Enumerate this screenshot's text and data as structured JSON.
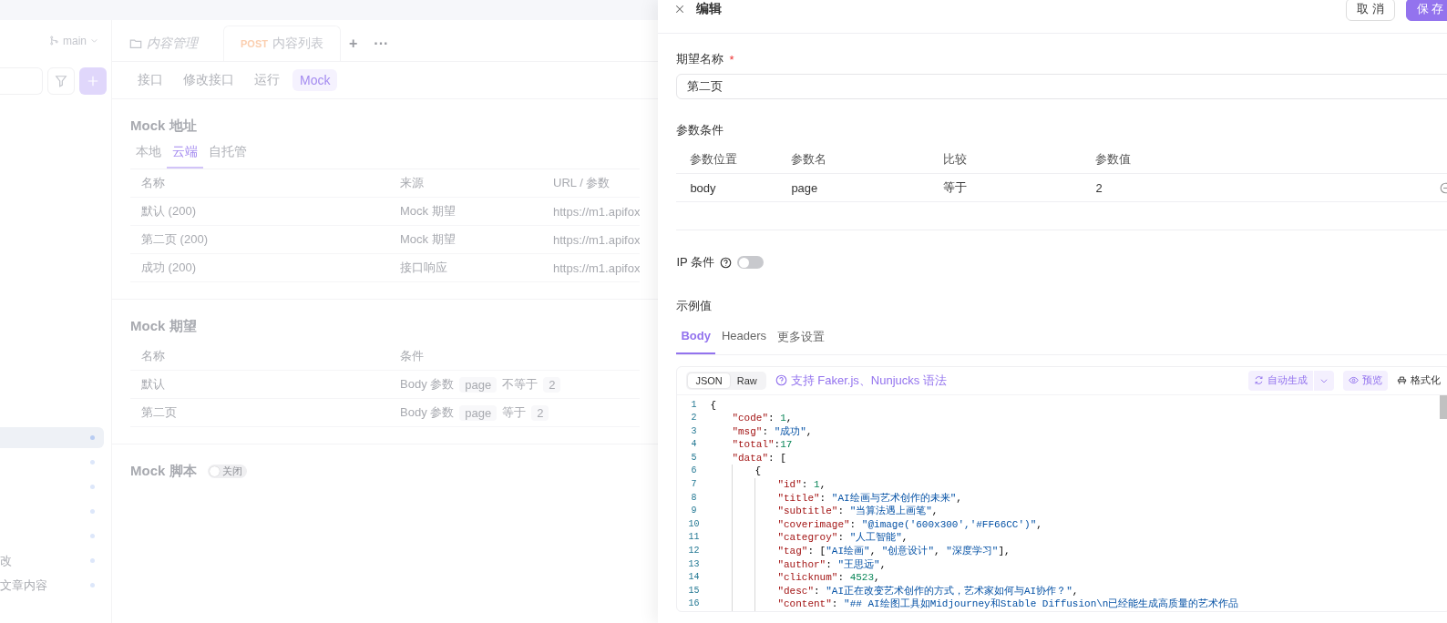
{
  "sidebar": {
    "branch": "main",
    "items": [
      {
        "selected": true
      },
      {
        "selected": false
      },
      {
        "selected": false
      },
      {
        "selected": false
      },
      {
        "selected": false
      },
      {
        "label": "改",
        "selected": false
      },
      {
        "label": "文章内容",
        "selected": false
      }
    ]
  },
  "doc_tabs": [
    {
      "kind": "folder",
      "label": "内容管理",
      "selected": false
    },
    {
      "kind": "api",
      "method": "POST",
      "label": "内容列表",
      "selected": true
    }
  ],
  "tab_actions": [
    "+",
    "···"
  ],
  "sub_tabs": [
    {
      "label": "接口",
      "selected": false
    },
    {
      "label": "修改接口",
      "selected": false
    },
    {
      "label": "运行",
      "selected": false
    },
    {
      "label": "Mock",
      "selected": true
    }
  ],
  "mock_address": {
    "title": "Mock 地址",
    "tabs": [
      {
        "label": "本地",
        "selected": false
      },
      {
        "label": "云端",
        "selected": true
      },
      {
        "label": "自托管",
        "selected": false
      }
    ],
    "columns": [
      "名称",
      "来源",
      "URL / 参数"
    ],
    "rows": [
      [
        "默认 (200)",
        "Mock 期望",
        "https://m1.apifox"
      ],
      [
        "第二页 (200)",
        "Mock 期望",
        "https://m1.apifox"
      ],
      [
        "成功 (200)",
        "接口响应",
        "https://m1.apifox"
      ]
    ]
  },
  "mock_expectations": {
    "title": "Mock 期望",
    "columns": [
      "名称",
      "条件"
    ],
    "rows": [
      {
        "name": "默认",
        "source": "Body 参数",
        "param": "page",
        "op": "不等于",
        "value": "2"
      },
      {
        "name": "第二页",
        "source": "Body 参数",
        "param": "page",
        "op": "等于",
        "value": "2"
      }
    ]
  },
  "mock_script": {
    "title": "Mock 脚本",
    "toggle_label": "关闭",
    "on": false
  },
  "drawer": {
    "title": "编辑",
    "cancel": "取 消",
    "save": "保 存",
    "name_label": "期望名称",
    "required_mark": "*",
    "name_value": "第二页",
    "conditions_label": "参数条件",
    "condition_columns": [
      "参数位置",
      "参数名",
      "比较",
      "参数值"
    ],
    "conditions": [
      [
        "body",
        "page",
        "等于",
        "2"
      ]
    ],
    "ip_label": "IP 条件",
    "ip_on": false,
    "example_label": "示例值",
    "tabs": [
      {
        "label": "Body",
        "selected": true
      },
      {
        "label": "Headers",
        "selected": false
      },
      {
        "label": "更多设置",
        "selected": false
      }
    ],
    "formats": [
      {
        "label": "JSON",
        "selected": true
      },
      {
        "label": "Raw",
        "selected": false
      }
    ],
    "syntax_hint": "支持 Faker.js、Nunjucks 语法",
    "auto_generate": "自动生成",
    "preview": "预览",
    "format": "格式化",
    "line_numbers": [
      "1",
      "2",
      "3",
      "4",
      "5",
      "6",
      "7",
      "8",
      "9",
      "10",
      "11",
      "12",
      "13",
      "14",
      "15",
      "16"
    ],
    "code": [
      "{",
      "    \"code\": 1,",
      "    \"msg\": \"成功\",",
      "    \"total\":17",
      "    \"data\": [",
      "        {",
      "            \"id\": 1,",
      "            \"title\": \"AI绘画与艺术创作的未来\",",
      "            \"subtitle\": \"当算法遇上画笔\",",
      "            \"coverimage\": \"@image('600x300','#FF66CC')\",",
      "            \"categroy\": \"人工智能\",",
      "            \"tag\": [\"AI绘画\", \"创意设计\", \"深度学习\"],",
      "            \"author\": \"王思远\",",
      "            \"clicknum\": 4523,",
      "            \"desc\": \"AI正在改变艺术创作的方式，艺术家如何与AI协作？\",",
      "            \"content\": \"## AI绘图工具如Midjourney和Stable Diffusion\\n已经能生成高质量的艺术作品"
    ]
  }
}
